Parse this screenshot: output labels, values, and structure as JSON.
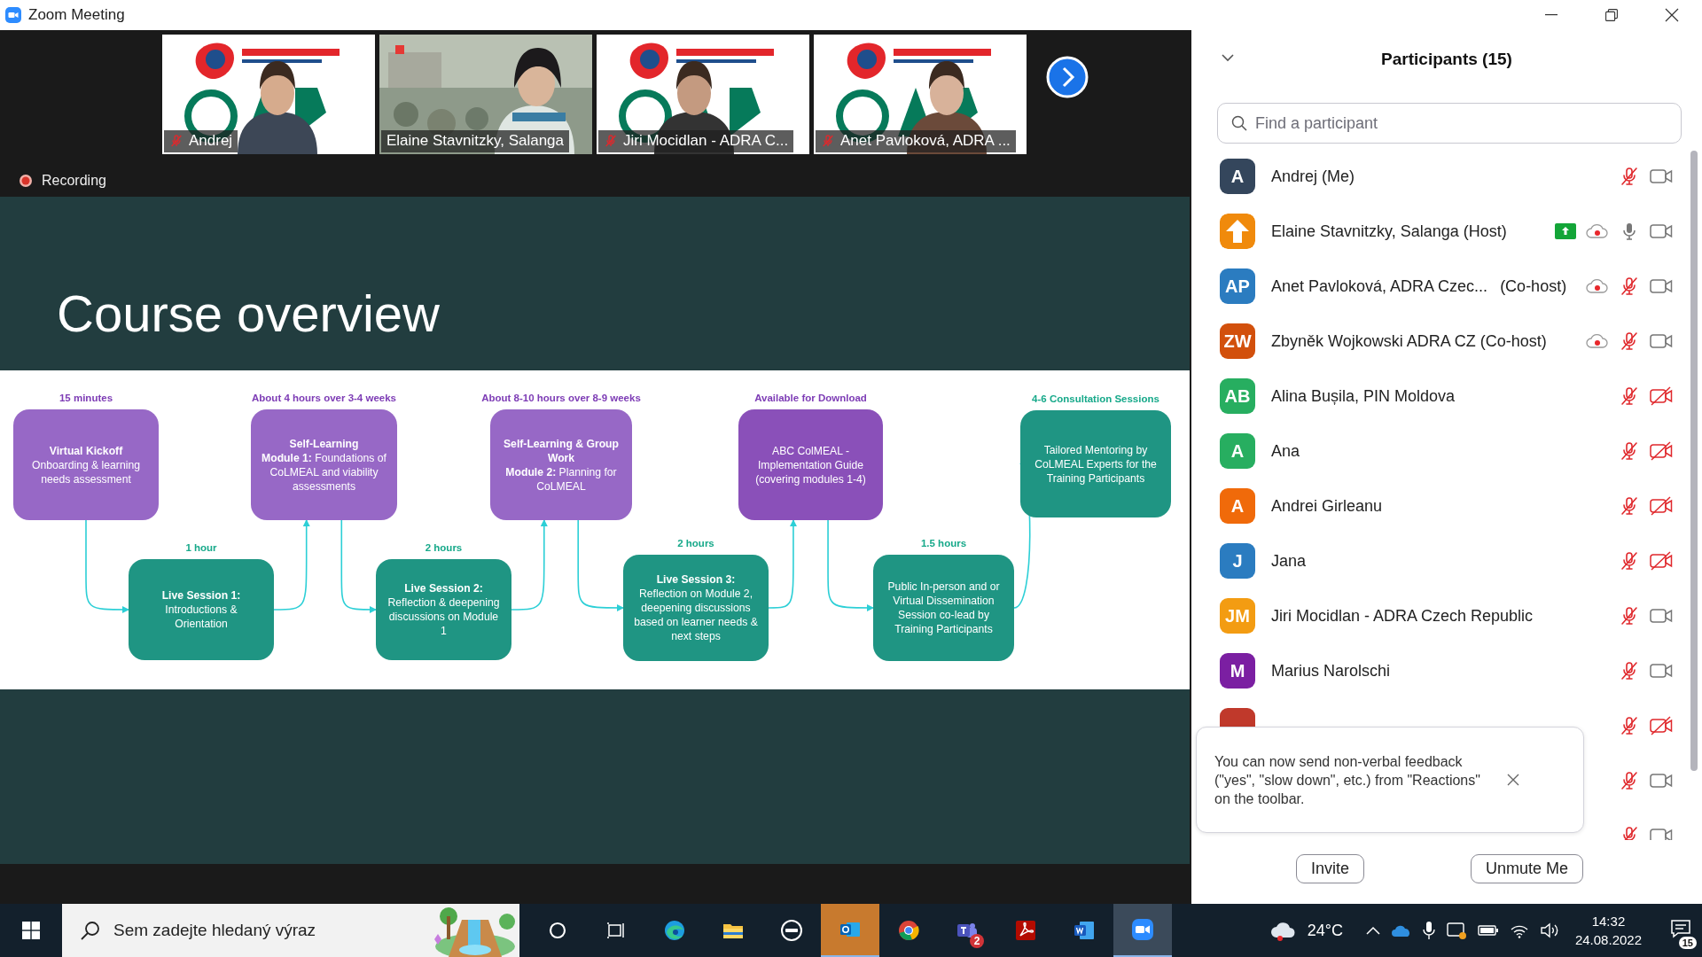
{
  "window": {
    "title": "Zoom Meeting"
  },
  "video_strip": {
    "tiles": [
      {
        "name": "Andrej",
        "muted": true,
        "speaking": false
      },
      {
        "name": "Elaine Stavnitzky, Salanga",
        "muted": false,
        "speaking": true
      },
      {
        "name": "Jiri Mocidlan - ADRA C...",
        "muted": true,
        "speaking": false
      },
      {
        "name": "Anet Pavloková, ADRA ...",
        "muted": true,
        "speaking": false
      }
    ]
  },
  "recording": {
    "label": "Recording"
  },
  "slide": {
    "title": "Course overview",
    "steps": [
      {
        "kind": "online",
        "label": "15 minutes",
        "heading": "Virtual Kickoff",
        "text": "Onboarding & learning needs assessment"
      },
      {
        "kind": "live",
        "label": "1 hour",
        "heading": "Live Session 1:",
        "text": "Introductions & Orientation"
      },
      {
        "kind": "online",
        "label": "About 4 hours over 3-4 weeks",
        "heading": "Self-Learning",
        "text": "**Module 1:** Foundations of CoLMEAL and viability assessments"
      },
      {
        "kind": "live",
        "label": "2 hours",
        "heading": "Live Session 2:",
        "text": "Reflection & deepening discussions on Module 1"
      },
      {
        "kind": "online",
        "label": "About 8-10 hours over 8-9 weeks",
        "heading": "Self-Learning & Group Work",
        "text": "**Module 2:** Planning for CoLMEAL"
      },
      {
        "kind": "live",
        "label": "2 hours",
        "heading": "Live Session 3:",
        "text": "Reflection on Module 2, deepening discussions based on learner needs & next steps"
      },
      {
        "kind": "resource",
        "label": "Available for Download",
        "text": "ABC ColMEAL - Implementation Guide (covering modules 1-4)"
      },
      {
        "kind": "live",
        "label": "1.5 hours",
        "text": "Public In-person and or Virtual Dissemination Session co-lead by Training Participants"
      },
      {
        "kind": "mentoring",
        "label": "4-6 Consultation Sessions",
        "text": "Tailored Mentoring by CoLMEAL Experts for the Training Participants"
      }
    ]
  },
  "participants_panel": {
    "title": "Participants (15)",
    "search": {
      "placeholder": "Find a participant"
    },
    "participants": [
      {
        "kind": "initials",
        "initials": "A",
        "color": "#34465c",
        "name": "Andrej (Me)",
        "sharing": false,
        "recording": false,
        "muted": true,
        "camera_on": true
      },
      {
        "color": "#f08a0c",
        "name": "Elaine Stavnitzky, Salanga (Host)",
        "sharing": true,
        "recording": true,
        "muted": false,
        "camera_on": true
      },
      {
        "kind": "initials",
        "initials": "AP",
        "color": "#2b7cc0",
        "name": "Anet Pavloková, ADRA Czec...",
        "role": "(Co-host)",
        "sharing": false,
        "recording": true,
        "muted": true,
        "camera_on": true
      },
      {
        "kind": "initials",
        "initials": "ZW",
        "color": "#d2500c",
        "name": "Zbyněk Wojkowski ADRA CZ (Co-host)",
        "sharing": false,
        "recording": true,
        "muted": true,
        "camera_on": true
      },
      {
        "kind": "initials",
        "initials": "AB",
        "color": "#27ae60",
        "name": "Alina Bușila, PIN Moldova",
        "sharing": false,
        "recording": false,
        "muted": true,
        "camera_on": false
      },
      {
        "kind": "initials",
        "initials": "A",
        "color": "#27ae60",
        "name": "Ana",
        "sharing": false,
        "recording": false,
        "muted": true,
        "camera_on": false
      },
      {
        "kind": "initials",
        "initials": "A",
        "color": "#f06a0a",
        "name": "Andrei Girleanu",
        "sharing": false,
        "recording": false,
        "muted": true,
        "camera_on": false
      },
      {
        "kind": "initials",
        "initials": "J",
        "color": "#2b7cc0",
        "name": "Jana",
        "sharing": false,
        "recording": false,
        "muted": true,
        "camera_on": false
      },
      {
        "kind": "initials",
        "initials": "JM",
        "color": "#f39c12",
        "name": "Jiri Mocidlan - ADRA Czech Republic",
        "sharing": false,
        "recording": false,
        "muted": true,
        "camera_on": true
      },
      {
        "kind": "initials",
        "initials": "M",
        "color": "#7b1fa2",
        "name": "Marius Narolschi",
        "sharing": false,
        "recording": false,
        "muted": true,
        "camera_on": true
      },
      {
        "kind": "initials",
        "color": "#c0392b",
        "sharing": false,
        "recording": false,
        "muted": true,
        "camera_on": false
      },
      {
        "sharing": false,
        "recording": false,
        "muted": true,
        "camera_on": true
      },
      {
        "sharing": false,
        "recording": false,
        "muted": true,
        "camera_on": true
      }
    ],
    "tip": {
      "text": "You can now send non-verbal feedback (\"yes\", \"slow down\", etc.) from \"Reactions\" on the toolbar."
    },
    "buttons": [
      "Invite",
      "Unmute Me"
    ]
  },
  "taskbar": {
    "search": {
      "placeholder": "Sem zadejte hledaný výraz"
    },
    "apps": [
      {
        "kind": "cortana",
        "active": false
      },
      {
        "kind": "taskview",
        "active": false
      },
      {
        "kind": "edge",
        "active": false
      },
      {
        "kind": "explorer",
        "active": false
      },
      {
        "kind": "dell",
        "active": false
      },
      {
        "kind": "outlook",
        "active": true
      },
      {
        "kind": "chrome",
        "active": false
      },
      {
        "kind": "teams",
        "active": false,
        "badge": "2"
      },
      {
        "kind": "acrobat",
        "active": false
      },
      {
        "kind": "word",
        "active": false
      },
      {
        "kind": "zoom",
        "active": true
      }
    ],
    "weather": "24°C",
    "time": "14:32",
    "date": "24.08.2022",
    "notifications": "15"
  }
}
